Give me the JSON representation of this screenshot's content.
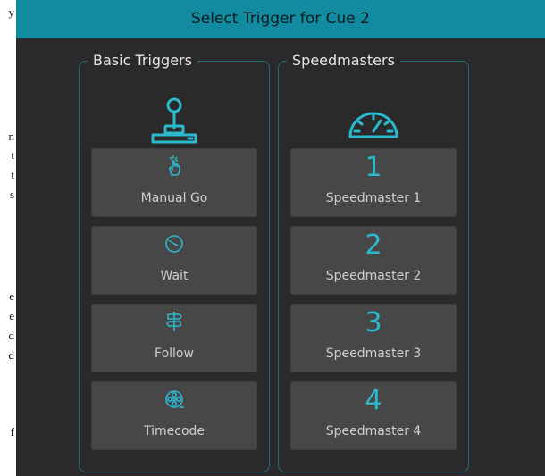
{
  "background_doc": {
    "fragments": [
      "y",
      "n",
      "t",
      "t",
      "s",
      "e",
      "e",
      "d",
      "d",
      "f"
    ]
  },
  "dialog": {
    "title": "Select Trigger for Cue 2",
    "accent_color": "#2ab9cd",
    "basic_triggers": {
      "legend": "Basic Triggers",
      "icon": "joystick-icon",
      "buttons": [
        {
          "label": "Manual Go",
          "icon": "hand-tap-icon"
        },
        {
          "label": "Wait",
          "icon": "clock-icon"
        },
        {
          "label": "Follow",
          "icon": "signpost-icon"
        },
        {
          "label": "Timecode",
          "icon": "reel-icon"
        }
      ]
    },
    "speedmasters": {
      "legend": "Speedmasters",
      "icon": "speedometer-icon",
      "buttons": [
        {
          "number": "1",
          "label": "Speedmaster 1"
        },
        {
          "number": "2",
          "label": "Speedmaster 2"
        },
        {
          "number": "3",
          "label": "Speedmaster 3"
        },
        {
          "number": "4",
          "label": "Speedmaster 4"
        }
      ]
    }
  }
}
